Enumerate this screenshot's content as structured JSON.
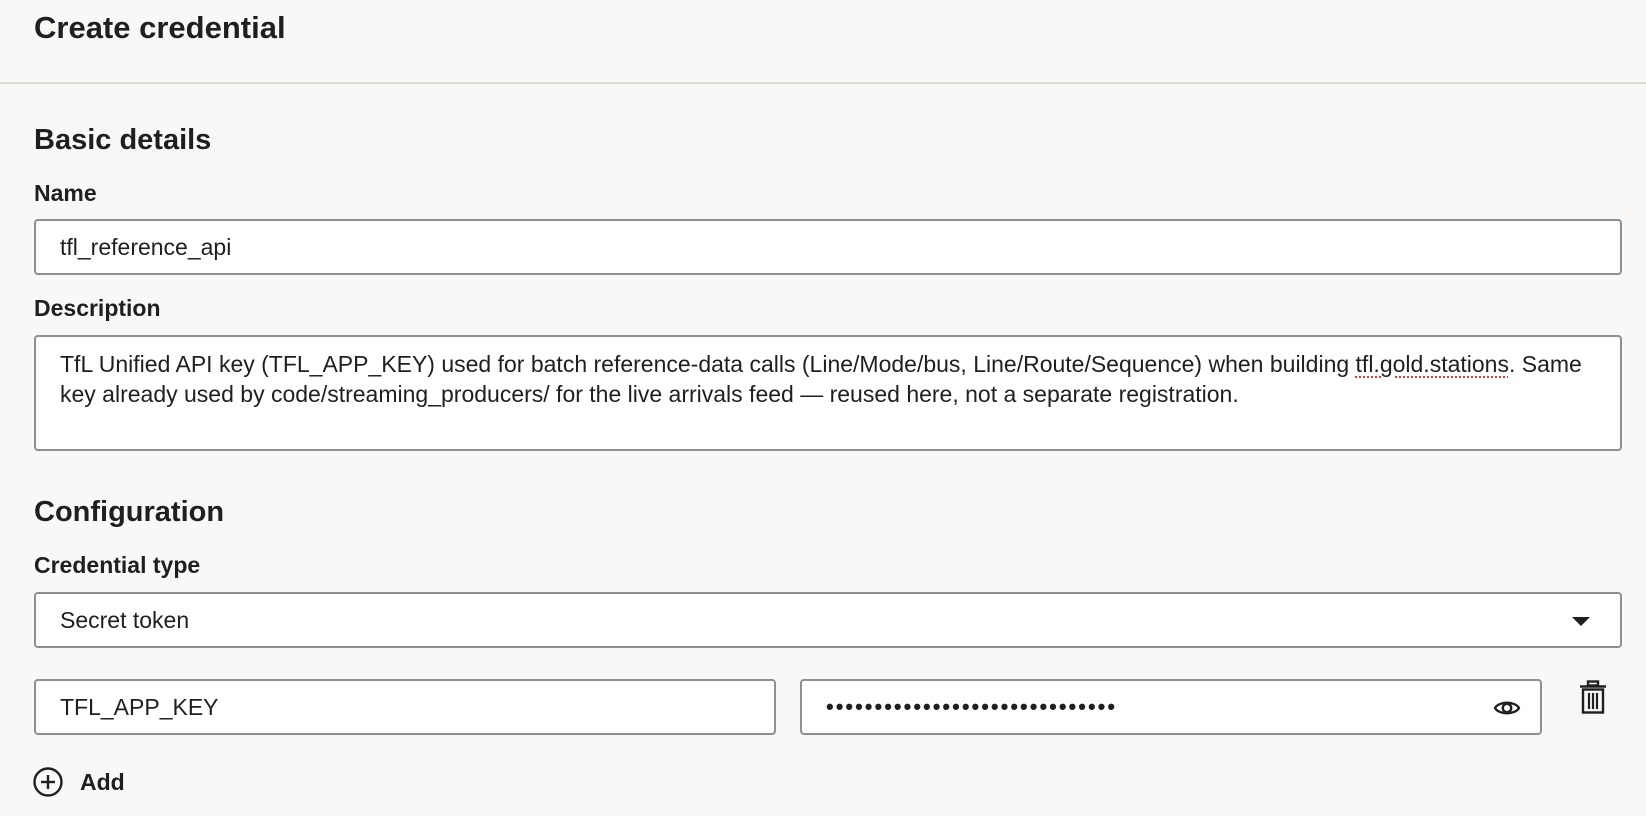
{
  "page": {
    "title": "Create credential"
  },
  "basic_details": {
    "section_title": "Basic details",
    "name_label": "Name",
    "name_value": "tfl_reference_api",
    "description_label": "Description",
    "description_part1": "TfL Unified API key (TFL_APP_KEY) used for batch reference-data calls (Line/Mode/bus, Line/Route/Sequence) when building ",
    "description_spell": "tfl.gold.stations",
    "description_part2": ". Same key already used by code/streaming_producers/ for the live arrivals feed — reused here, not a separate registration."
  },
  "configuration": {
    "section_title": "Configuration",
    "credential_type_label": "Credential type",
    "credential_type_value": "Secret token",
    "secret_key": "TFL_APP_KEY",
    "secret_value_masked": "••••••••••••••••••••••••••••••",
    "add_label": "Add"
  },
  "icons": {
    "dropdown": "chevron-down-icon",
    "reveal": "eye-icon",
    "delete": "trash-icon",
    "add": "plus-circle-icon"
  }
}
